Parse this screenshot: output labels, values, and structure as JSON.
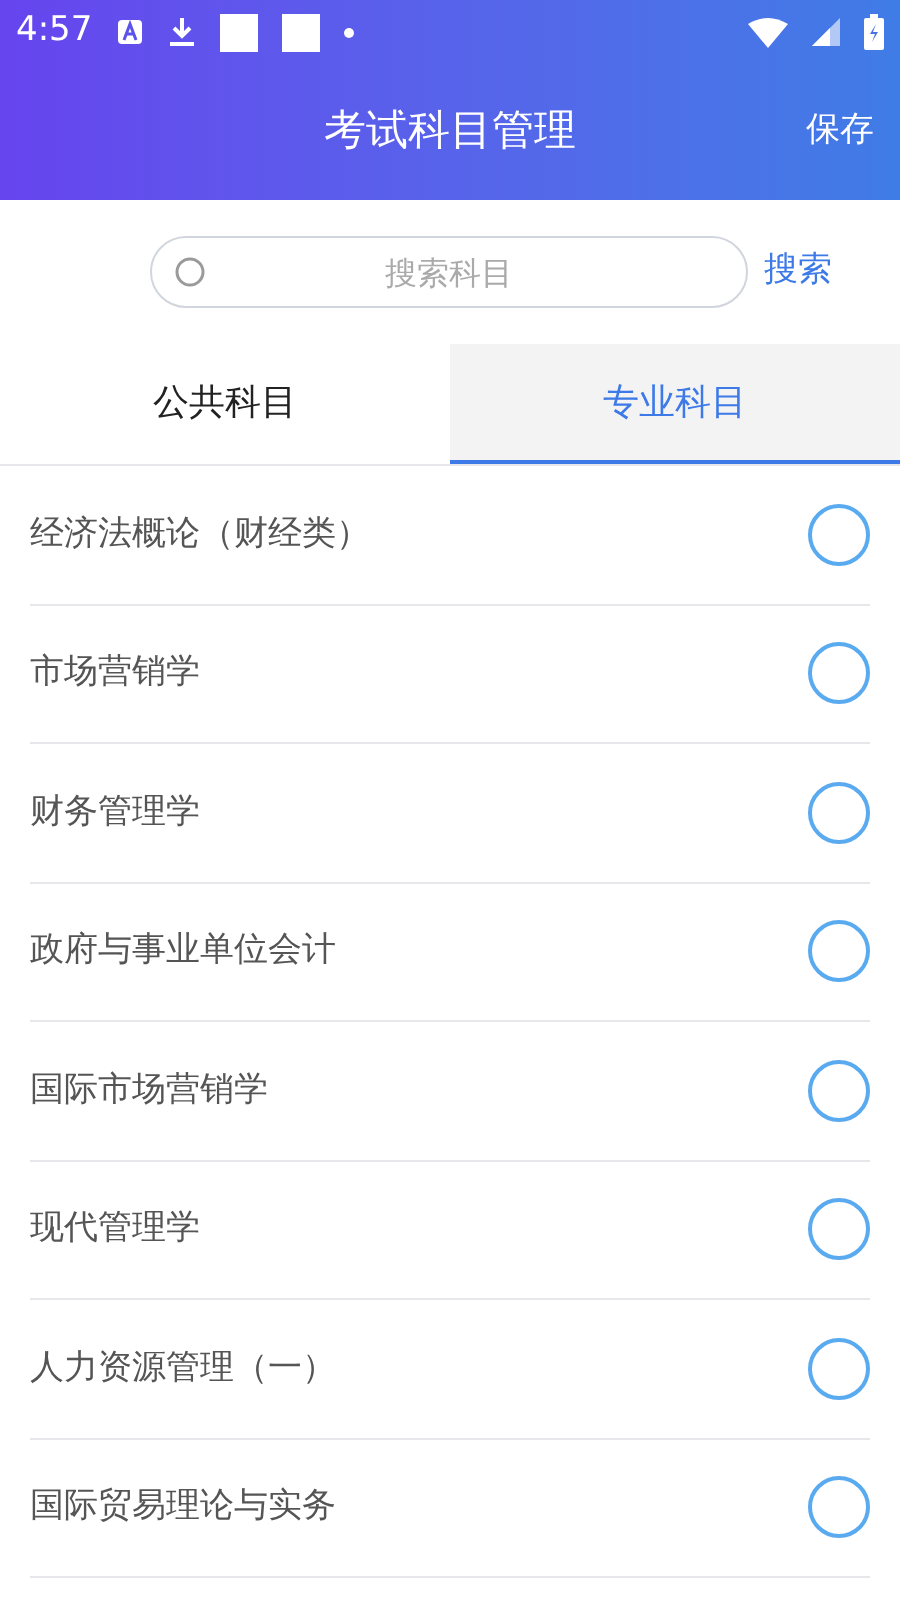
{
  "status_bar": {
    "time": "4:57"
  },
  "header": {
    "title": "考试科目管理",
    "action": "保存"
  },
  "search": {
    "placeholder": "搜索科目",
    "button": "搜索"
  },
  "tabs": [
    {
      "label": "公共科目",
      "selected": false
    },
    {
      "label": "专业科目",
      "selected": true
    }
  ],
  "subjects": [
    {
      "name": "经济法概论（财经类）",
      "checked": false
    },
    {
      "name": "市场营销学",
      "checked": false
    },
    {
      "name": "财务管理学",
      "checked": false
    },
    {
      "name": "政府与事业单位会计",
      "checked": false
    },
    {
      "name": "国际市场营销学",
      "checked": false
    },
    {
      "name": "现代管理学",
      "checked": false
    },
    {
      "name": "人力资源管理（一）",
      "checked": false
    },
    {
      "name": "国际贸易理论与实务",
      "checked": false
    }
  ]
}
